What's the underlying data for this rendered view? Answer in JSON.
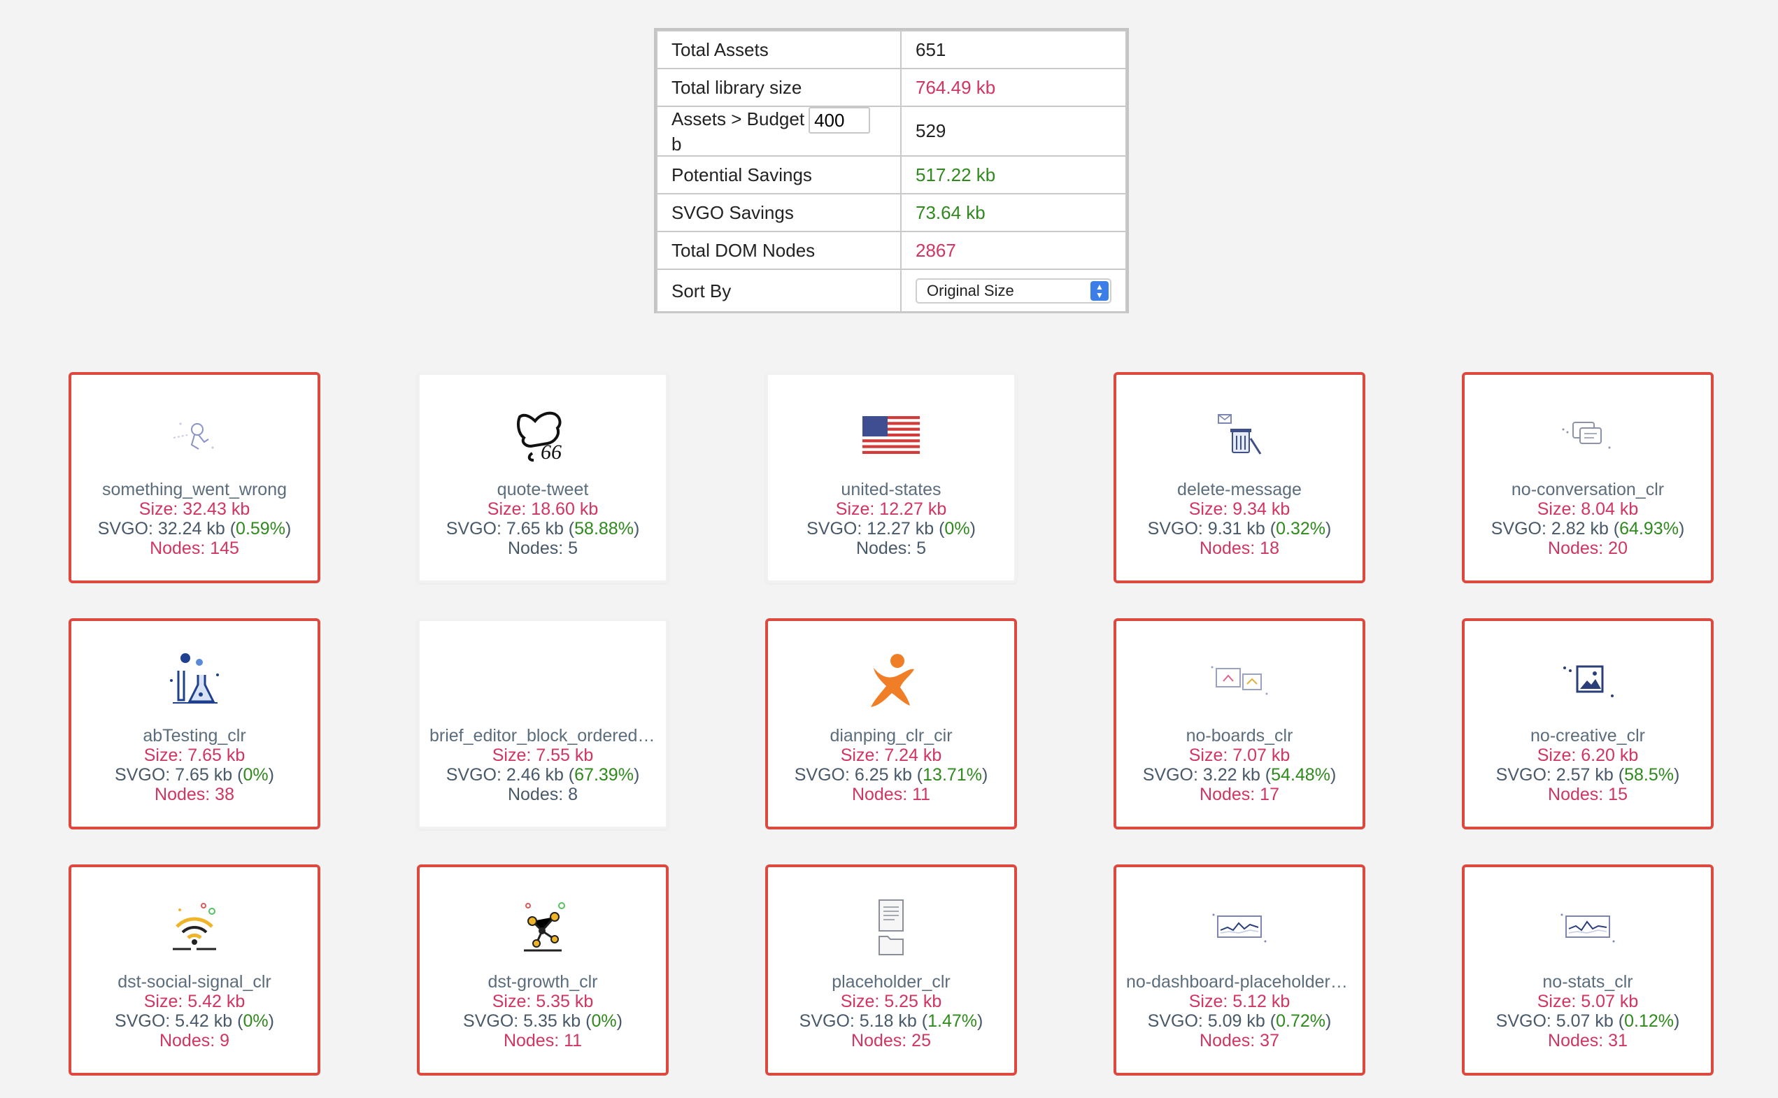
{
  "summary": {
    "total_assets_label": "Total Assets",
    "total_assets_value": "651",
    "library_size_label": "Total library size",
    "library_size_value": "764.49 kb",
    "budget_label": "Assets > Budget",
    "budget_input_value": "400",
    "budget_unit": "b",
    "budget_value": "529",
    "potential_savings_label": "Potential Savings",
    "potential_savings_value": "517.22 kb",
    "svgo_savings_label": "SVGO Savings",
    "svgo_savings_value": "73.64 kb",
    "dom_nodes_label": "Total DOM Nodes",
    "dom_nodes_value": "2867",
    "sort_label": "Sort By",
    "sort_selected": "Original Size"
  },
  "colors": {
    "over_budget_border": "#dc4a3f",
    "size_text": "#d13562",
    "savings_text": "#2f8a1d",
    "select_accent": "#3b7ee8"
  },
  "cards": [
    {
      "name": "something_went_wrong",
      "size": "Size: 32.43 kb",
      "svgo": "SVGO: 32.24 kb (",
      "pct": "0.59%",
      "nodes": "Nodes: 145",
      "over": true,
      "icon": "astronaut-icon"
    },
    {
      "name": "quote-tweet",
      "size": "Size: 18.60 kb",
      "svgo": "SVGO: 7.65 kb (",
      "pct": "58.88%",
      "nodes": "Nodes: 5",
      "over": false,
      "icon": "quote-tweet-icon"
    },
    {
      "name": "united-states",
      "size": "Size: 12.27 kb",
      "svgo": "SVGO: 12.27 kb (",
      "pct": "0%",
      "nodes": "Nodes: 5",
      "over": false,
      "icon": "us-flag-icon"
    },
    {
      "name": "delete-message",
      "size": "Size: 9.34 kb",
      "svgo": "SVGO: 9.31 kb (",
      "pct": "0.32%",
      "nodes": "Nodes: 18",
      "over": true,
      "icon": "trash-message-icon"
    },
    {
      "name": "no-conversation_clr",
      "size": "Size: 8.04 kb",
      "svgo": "SVGO: 2.82 kb (",
      "pct": "64.93%",
      "nodes": "Nodes: 20",
      "over": true,
      "icon": "chat-bubbles-icon"
    },
    {
      "name": "abTesting_clr",
      "size": "Size: 7.65 kb",
      "svgo": "SVGO: 7.65 kb (",
      "pct": "0%",
      "nodes": "Nodes: 38",
      "over": true,
      "icon": "flask-icon"
    },
    {
      "name": "brief_editor_block_ordered_list",
      "size": "Size: 7.55 kb",
      "svgo": "SVGO: 2.46 kb (",
      "pct": "67.39%",
      "nodes": "Nodes: 8",
      "over": false,
      "icon": "blank-icon"
    },
    {
      "name": "dianping_clr_cir",
      "size": "Size: 7.24 kb",
      "svgo": "SVGO: 6.25 kb (",
      "pct": "13.71%",
      "nodes": "Nodes: 11",
      "over": true,
      "icon": "dianping-icon"
    },
    {
      "name": "no-boards_clr",
      "size": "Size: 7.07 kb",
      "svgo": "SVGO: 3.22 kb (",
      "pct": "54.48%",
      "nodes": "Nodes: 17",
      "over": true,
      "icon": "boards-icon"
    },
    {
      "name": "no-creative_clr",
      "size": "Size: 6.20 kb",
      "svgo": "SVGO: 2.57 kb (",
      "pct": "58.5%",
      "nodes": "Nodes: 15",
      "over": true,
      "icon": "image-frame-icon"
    },
    {
      "name": "dst-social-signal_clr",
      "size": "Size: 5.42 kb",
      "svgo": "SVGO: 5.42 kb (",
      "pct": "0%",
      "nodes": "Nodes: 9",
      "over": true,
      "icon": "wifi-signal-icon"
    },
    {
      "name": "dst-growth_clr",
      "size": "Size: 5.35 kb",
      "svgo": "SVGO: 5.35 kb (",
      "pct": "0%",
      "nodes": "Nodes: 11",
      "over": true,
      "icon": "growth-network-icon"
    },
    {
      "name": "placeholder_clr",
      "size": "Size: 5.25 kb",
      "svgo": "SVGO: 5.18 kb (",
      "pct": "1.47%",
      "nodes": "Nodes: 25",
      "over": true,
      "icon": "document-folder-icon"
    },
    {
      "name": "no-dashboard-placeholder_clr",
      "size": "Size: 5.12 kb",
      "svgo": "SVGO: 5.09 kb (",
      "pct": "0.72%",
      "nodes": "Nodes: 37",
      "over": true,
      "icon": "dashboard-chart-icon"
    },
    {
      "name": "no-stats_clr",
      "size": "Size: 5.07 kb",
      "svgo": "SVGO: 5.07 kb (",
      "pct": "0.12%",
      "nodes": "Nodes: 31",
      "over": true,
      "icon": "stats-chart-icon"
    }
  ]
}
